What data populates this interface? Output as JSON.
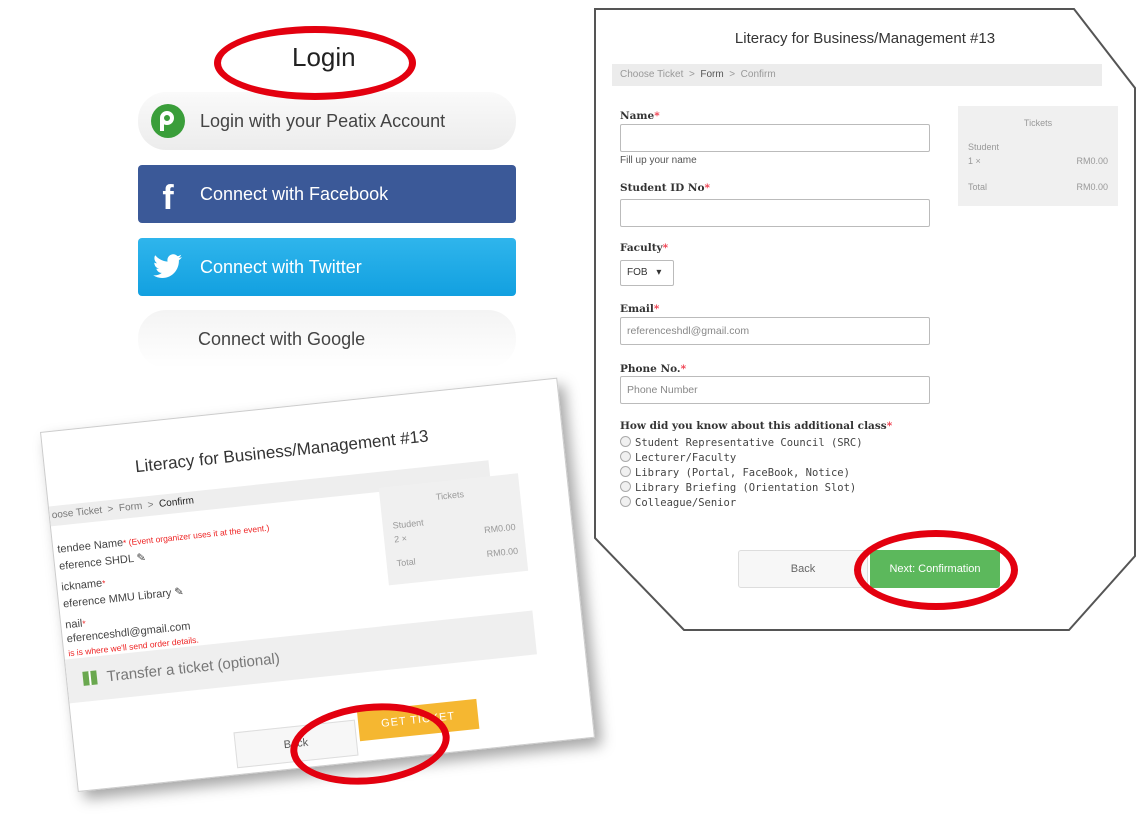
{
  "login": {
    "title": "Login",
    "peatix_label": "Login with your Peatix Account",
    "facebook_label": "Connect with Facebook",
    "twitter_label": "Connect with Twitter",
    "google_label": "Connect with Google",
    "colors": {
      "facebook": "#3b5998",
      "twitter": "#1da9e6",
      "peatix": "#3a9e3a",
      "highlight": "#e3000f"
    },
    "icons": {
      "peatix": "peatix-logo-icon",
      "facebook": "facebook-icon",
      "twitter": "twitter-bird-icon"
    }
  },
  "form": {
    "title": "Literacy for Business/Management #13",
    "steps": [
      "Choose Ticket",
      "Form",
      "Confirm"
    ],
    "step_sep": ">",
    "name_label": "Name",
    "name_help": "Fill up your name",
    "student_id_label": "Student ID No",
    "faculty_label": "Faculty",
    "faculty_value": "FOB",
    "email_label": "Email",
    "email_value": "referenceshdl@gmail.com",
    "phone_label": "Phone No.",
    "phone_placeholder": "Phone Number",
    "how_label": "How did you know about this additional class",
    "how_options": [
      "Student Representative Council (SRC)",
      "Lecturer/Faculty",
      "Library (Portal, FaceBook, Notice)",
      "Library Briefing (Orientation Slot)",
      "Colleague/Senior"
    ],
    "required_mark": "*",
    "tickets": {
      "header": "Tickets",
      "item_name": "Student",
      "item_qty": "1 ×",
      "item_price": "RM0.00",
      "total_label": "Total",
      "total_value": "RM0.00"
    },
    "back_label": "Back",
    "next_label": "Next: Confirmation",
    "next_color": "#5cb85c"
  },
  "confirm": {
    "title": "Literacy for Business/Management #13",
    "steps_text_a": "oose Ticket",
    "steps_text_b": "Form",
    "steps_text_c": "Confirm",
    "step_sep": ">",
    "attendee_label": "tendee Name",
    "attendee_note": "(Event organizer uses it at the event.)",
    "attendee_value": "eference SHDL",
    "nickname_label": "ickname",
    "nickname_value": "eference MMU Library",
    "email_label": "nail",
    "email_value": "eferenceshdl@gmail.com",
    "email_note": "is is where we'll send order details.",
    "tickets": {
      "header": "Tickets",
      "item_name": "Student",
      "item_qty": "2 ×",
      "item_price": "RM0.00",
      "total_label": "Total",
      "total_value": "RM0.00"
    },
    "transfer_label": "Transfer a ticket (optional)",
    "back_label": "Back",
    "get_ticket_label": "GET TICKET",
    "get_ticket_color": "#f5b731"
  }
}
